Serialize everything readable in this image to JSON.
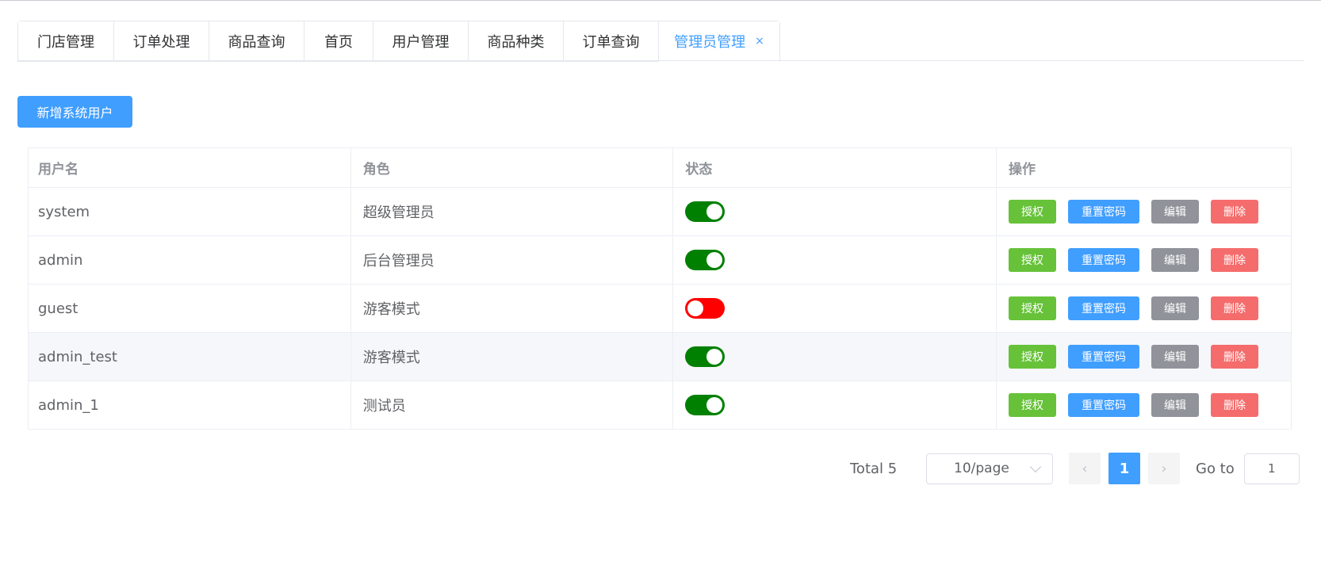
{
  "tabs": [
    {
      "label": "门店管理"
    },
    {
      "label": "订单处理"
    },
    {
      "label": "商品查询"
    },
    {
      "label": "首页"
    },
    {
      "label": "用户管理"
    },
    {
      "label": "商品种类"
    },
    {
      "label": "订单查询"
    },
    {
      "label": "管理员管理",
      "active": true,
      "close": "×"
    }
  ],
  "toolbar": {
    "add_label": "新增系统用户"
  },
  "table": {
    "headers": [
      "用户名",
      "角色",
      "状态",
      "操作"
    ],
    "rows": [
      {
        "username": "system",
        "role": "超级管理员",
        "enabled": true
      },
      {
        "username": "admin",
        "role": "后台管理员",
        "enabled": true
      },
      {
        "username": "guest",
        "role": "游客模式",
        "enabled": false
      },
      {
        "username": "admin_test",
        "role": "游客模式",
        "enabled": true
      },
      {
        "username": "admin_1",
        "role": "测试员",
        "enabled": true
      }
    ],
    "actions": {
      "auth": "授权",
      "reset": "重置密码",
      "edit": "编辑",
      "delete": "删除"
    }
  },
  "pagination": {
    "total": "Total 5",
    "page_size": "10/page",
    "prev_icon": "‹",
    "current_page": "1",
    "next_icon": "›",
    "goto_label": "Go to",
    "goto_value": "1"
  },
  "colors": {
    "primary": "#409eff",
    "success": "#67c23a",
    "info": "#909399",
    "danger": "#f56c6c",
    "switch_on": "#008000",
    "switch_off": "#ff0000"
  }
}
